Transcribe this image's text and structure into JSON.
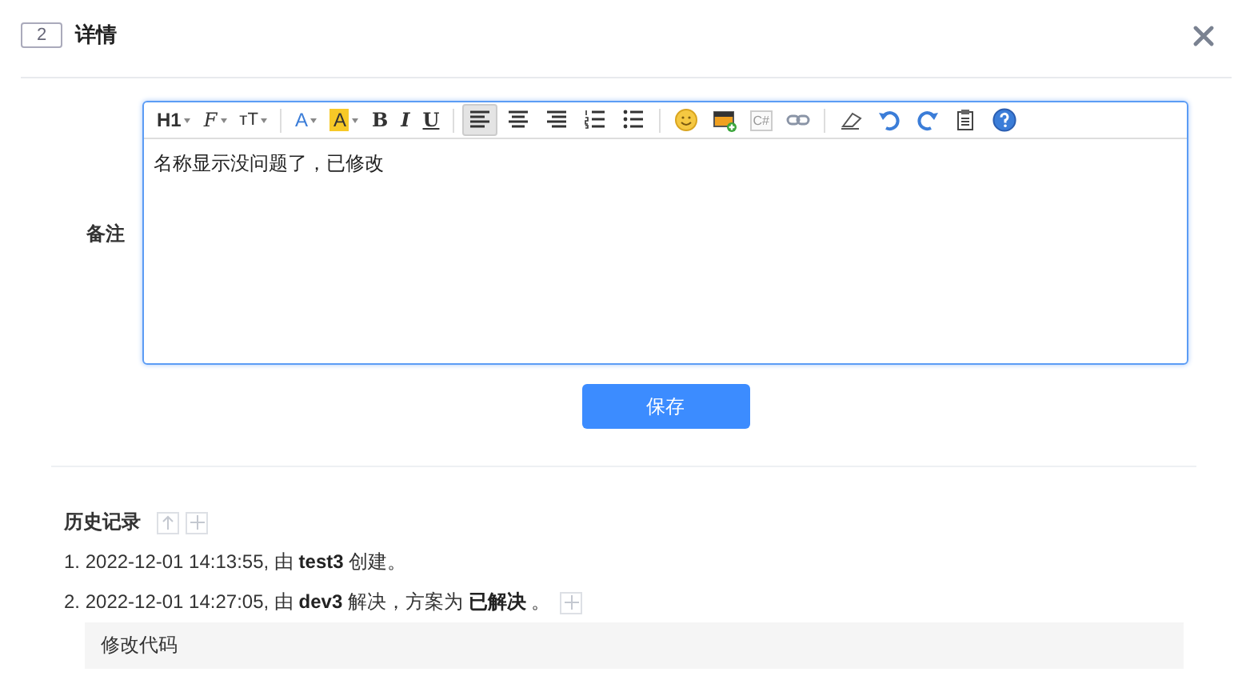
{
  "dialog": {
    "index": "2",
    "title": "详情"
  },
  "form": {
    "label": "备注",
    "editor": {
      "toolbar": [
        {
          "kind": "heading",
          "label": "H1",
          "dropdown": true,
          "selected": false
        },
        {
          "kind": "font",
          "label": "F",
          "dropdown": true,
          "selected": false
        },
        {
          "kind": "size",
          "label": "ᴛT",
          "dropdown": true,
          "selected": false
        },
        {
          "kind": "separator"
        },
        {
          "kind": "forecolor",
          "label": "A",
          "dropdown": true,
          "selected": false
        },
        {
          "kind": "highlight",
          "label": "A",
          "dropdown": true,
          "selected": false
        },
        {
          "kind": "bold",
          "label": "B",
          "dropdown": false,
          "selected": false
        },
        {
          "kind": "italic",
          "label": "I",
          "dropdown": false,
          "selected": false
        },
        {
          "kind": "underline",
          "label": "U",
          "dropdown": false,
          "selected": false
        },
        {
          "kind": "separator"
        },
        {
          "kind": "align-left",
          "selected": true
        },
        {
          "kind": "align-center",
          "selected": false
        },
        {
          "kind": "align-right",
          "selected": false
        },
        {
          "kind": "ordered-list",
          "selected": false
        },
        {
          "kind": "bullet-list",
          "selected": false
        },
        {
          "kind": "separator"
        },
        {
          "kind": "emoji",
          "selected": false
        },
        {
          "kind": "image",
          "selected": false
        },
        {
          "kind": "code",
          "label": "C#",
          "dropdown": false,
          "selected": false
        },
        {
          "kind": "link",
          "selected": false
        },
        {
          "kind": "separator"
        },
        {
          "kind": "eraser",
          "selected": false
        },
        {
          "kind": "undo",
          "selected": false
        },
        {
          "kind": "redo",
          "selected": false
        },
        {
          "kind": "paste",
          "selected": false
        },
        {
          "kind": "help",
          "selected": false
        }
      ],
      "value": "名称显示没问题了，已修改"
    },
    "save": "保存"
  },
  "history": {
    "title": "历史记录",
    "items": [
      {
        "text": "1. 2022-12-01 14:13:55, 由 **test3** 创建。",
        "add_button": false
      },
      {
        "text": "2. 2022-12-01 14:27:05, 由 **dev3** 解决，方案为 **已解决** 。",
        "add_button": true,
        "comment": "修改代码"
      }
    ]
  }
}
